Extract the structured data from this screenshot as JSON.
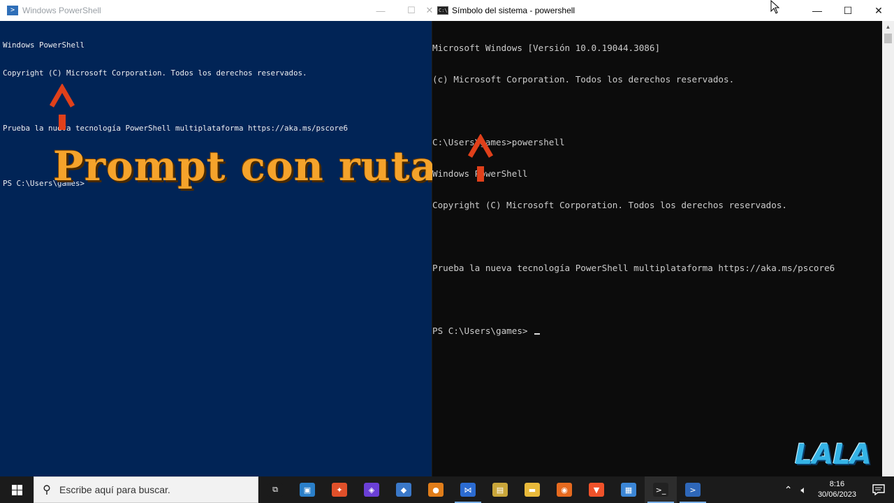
{
  "ps_window": {
    "title": "Windows PowerShell",
    "icon": "powershell-icon",
    "lines": [
      "Windows PowerShell",
      "Copyright (C) Microsoft Corporation. Todos los derechos reservados.",
      "",
      "Prueba la nueva tecnología PowerShell multiplataforma https://aka.ms/pscore6",
      "",
      "PS C:\\Users\\games>"
    ],
    "background": "#012456"
  },
  "overlay": {
    "text": "Prompt con ruta",
    "color": "#f5a32b"
  },
  "cmd_window": {
    "title": "Símbolo del sistema - powershell",
    "icon": "cmd-icon",
    "lines": [
      "Microsoft Windows [Versión 10.0.19044.3086]",
      "(c) Microsoft Corporation. Todos los derechos reservados.",
      "",
      "C:\\Users\\games>powershell",
      "Windows PowerShell",
      "Copyright (C) Microsoft Corporation. Todos los derechos reservados.",
      "",
      "Prueba la nueva tecnología PowerShell multiplataforma https://aka.ms/pscore6",
      "",
      "PS C:\\Users\\games> "
    ],
    "background": "#0c0c0c"
  },
  "window_controls": {
    "minimize": "—",
    "maximize": "☐",
    "close": "✕"
  },
  "arrow_color": "#e0401a",
  "watermark": "LALA",
  "taskbar": {
    "search_placeholder": "Escribe aquí para buscar.",
    "icons": [
      {
        "name": "task-view-icon",
        "glyph": "⧉",
        "color": "#1b1b1b"
      },
      {
        "name": "photo-app-icon",
        "glyph": "▣",
        "color": "#2a7fc9"
      },
      {
        "name": "creative-app-icon",
        "glyph": "✦",
        "color": "#e0502a"
      },
      {
        "name": "purple-app-icon",
        "glyph": "◈",
        "color": "#6a3fd6"
      },
      {
        "name": "virtualbox-icon",
        "glyph": "◆",
        "color": "#3a78c9"
      },
      {
        "name": "media-app-icon",
        "glyph": "●",
        "color": "#e07d1a"
      },
      {
        "name": "visual-studio-icon",
        "glyph": "⋈",
        "color": "#2b6bd1"
      },
      {
        "name": "files-app-icon",
        "glyph": "▤",
        "color": "#c9a63a"
      },
      {
        "name": "file-explorer-icon",
        "glyph": "▬",
        "color": "#e8b93a"
      },
      {
        "name": "firefox-icon",
        "glyph": "◉",
        "color": "#e66a1f"
      },
      {
        "name": "brave-icon",
        "glyph": "▼",
        "color": "#f0522a"
      },
      {
        "name": "remote-desktop-icon",
        "glyph": "▦",
        "color": "#3b86d6"
      },
      {
        "name": "terminal-icon",
        "glyph": ">_",
        "color": "#222222"
      },
      {
        "name": "powershell-taskbar-icon",
        "glyph": ">",
        "color": "#2e67b9"
      }
    ],
    "time": "8:16",
    "date": "30/06/2023"
  }
}
